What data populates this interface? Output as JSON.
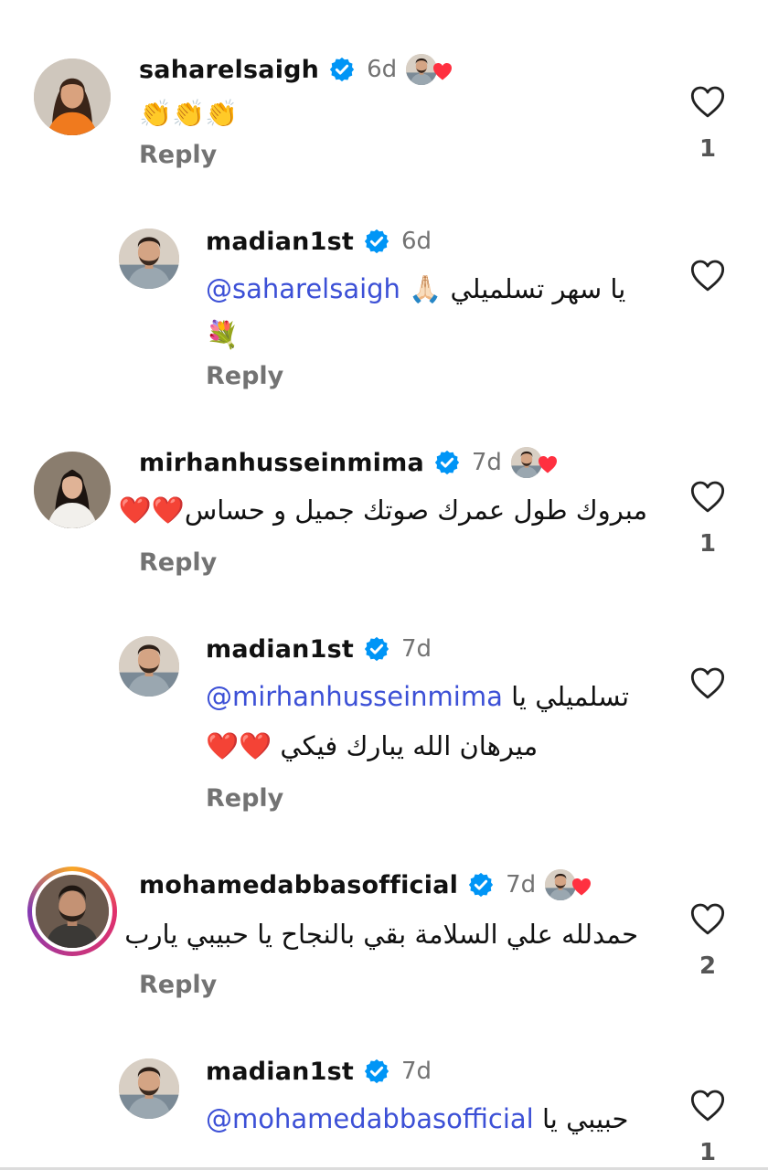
{
  "comments": [
    {
      "username": "saharelsaigh",
      "time": "6d",
      "text": "👏👏👏",
      "reply_label": "Reply",
      "likes": "1",
      "liked_by_author": true
    },
    {
      "username": "madian1st",
      "time": "6d",
      "mention": "@saharelsaigh",
      "text": "يا سهر تسلميلي 🙏🏻",
      "text_line2": "💐",
      "reply_label": "Reply",
      "likes": "",
      "liked_by_author": false
    },
    {
      "username": "mirhanhusseinmima",
      "time": "7d",
      "text": "مبروك طول عمرك صوتك جميل و حساس❤️❤️",
      "reply_label": "Reply",
      "likes": "1",
      "liked_by_author": true
    },
    {
      "username": "madian1st",
      "time": "7d",
      "mention": "@mirhanhusseinmima",
      "text": "تسلميلي يا",
      "text_line2": "ميرهان الله يبارك فيكي ❤️❤️",
      "reply_label": "Reply",
      "likes": "",
      "liked_by_author": false
    },
    {
      "username": "mohamedabbasofficial",
      "time": "7d",
      "text": "حمدلله علي السلامة بقي بالنجاح يا حبيبي يارب",
      "reply_label": "Reply",
      "likes": "2",
      "liked_by_author": true
    },
    {
      "username": "madian1st",
      "time": "7d",
      "mention": "@mohamedabbasofficial",
      "text": "حبيبي يا",
      "likes": "1",
      "liked_by_author": false
    }
  ],
  "colors": {
    "mention": "#3c50d6",
    "verified": "#0095f6",
    "heart_red": "#ff3040",
    "muted": "#737373"
  },
  "icons": {
    "verified": "verified-badge-icon",
    "like": "heart-outline-icon",
    "liked_by_author": "red-heart-icon"
  }
}
